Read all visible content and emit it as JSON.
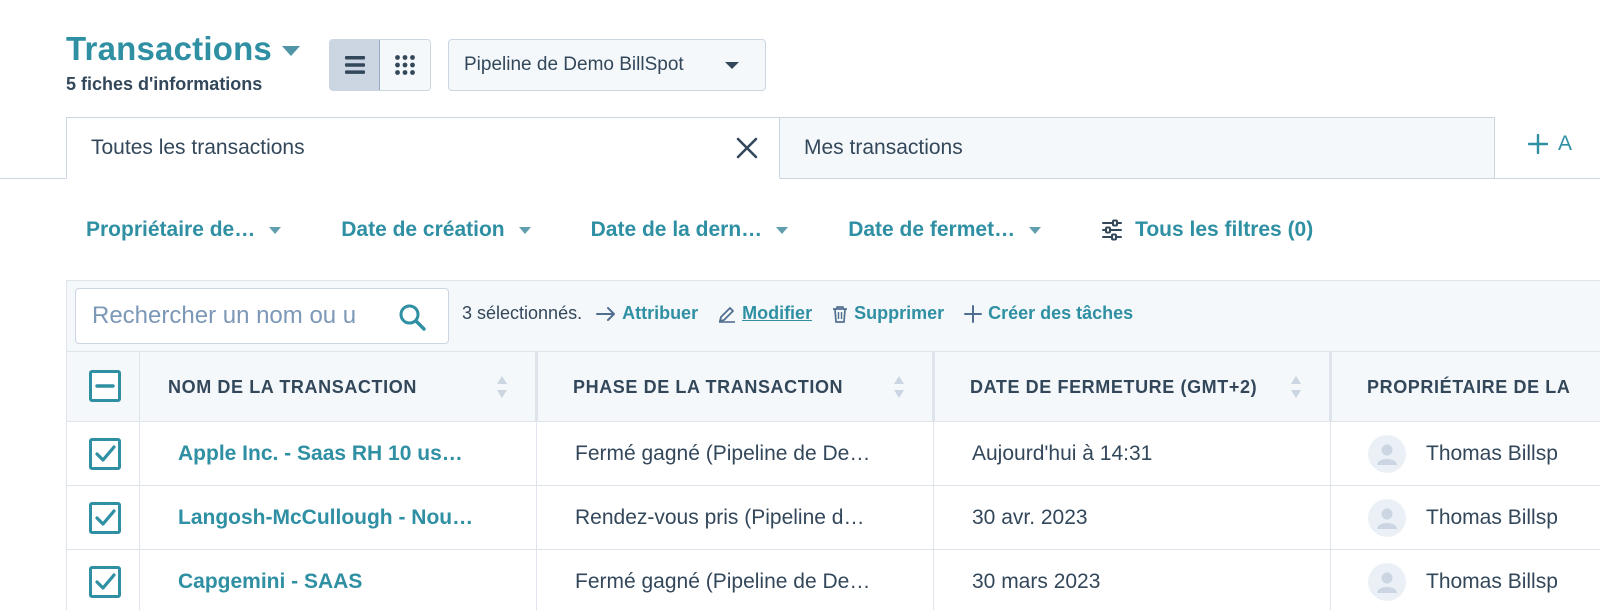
{
  "header": {
    "title": "Transactions",
    "subtitle": "5 fiches d'informations"
  },
  "pipeline_select": {
    "value": "Pipeline de Demo BillSpot"
  },
  "tabs": [
    {
      "label": "Toutes les transactions",
      "active": true
    },
    {
      "label": "Mes transactions",
      "active": false
    }
  ],
  "add_tab_label": "A",
  "filters": [
    {
      "label": "Propriétaire de…"
    },
    {
      "label": "Date de création"
    },
    {
      "label": "Date de la dern…"
    },
    {
      "label": "Date de fermet…"
    }
  ],
  "all_filters_label": "Tous les filtres (0)",
  "search": {
    "placeholder": "Rechercher un nom ou u"
  },
  "bulk_actions": {
    "selected_count": "3 sélectionnés.",
    "assign": "Attribuer",
    "edit": "Modifier",
    "delete": "Supprimer",
    "create_tasks": "Créer des tâches"
  },
  "table": {
    "columns": [
      "NOM DE LA TRANSACTION",
      "PHASE DE LA TRANSACTION",
      "DATE DE FERMETURE (GMT+2)",
      "PROPRIÉTAIRE DE LA"
    ],
    "rows": [
      {
        "name": "Apple Inc. - Saas RH 10 us…",
        "phase": "Fermé gagné (Pipeline de De…",
        "close_date": "Aujourd'hui à 14:31",
        "owner": "Thomas Billsp"
      },
      {
        "name": "Langosh-McCullough - Nou…",
        "phase": "Rendez-vous pris (Pipeline d…",
        "close_date": "30 avr. 2023",
        "owner": "Thomas Billsp"
      },
      {
        "name": "Capgemini - SAAS",
        "phase": "Fermé gagné (Pipeline de De…",
        "close_date": "30 mars 2023",
        "owner": "Thomas Billsp"
      }
    ]
  },
  "colors": {
    "accent": "#2f8fa3",
    "text": "#33475b",
    "surface": "#f5f8fa",
    "border": "#cbd6e2"
  },
  "icons": {
    "list_view": "list-icon",
    "grid_view": "grid-icon",
    "close_tab": "close-icon",
    "add_tab": "plus-icon",
    "filters": "sliders-icon",
    "search": "search-icon",
    "assign": "arrow-right-icon",
    "edit": "pencil-icon",
    "delete": "trash-icon",
    "create_tasks": "plus-icon",
    "owner": "avatar-icon"
  }
}
